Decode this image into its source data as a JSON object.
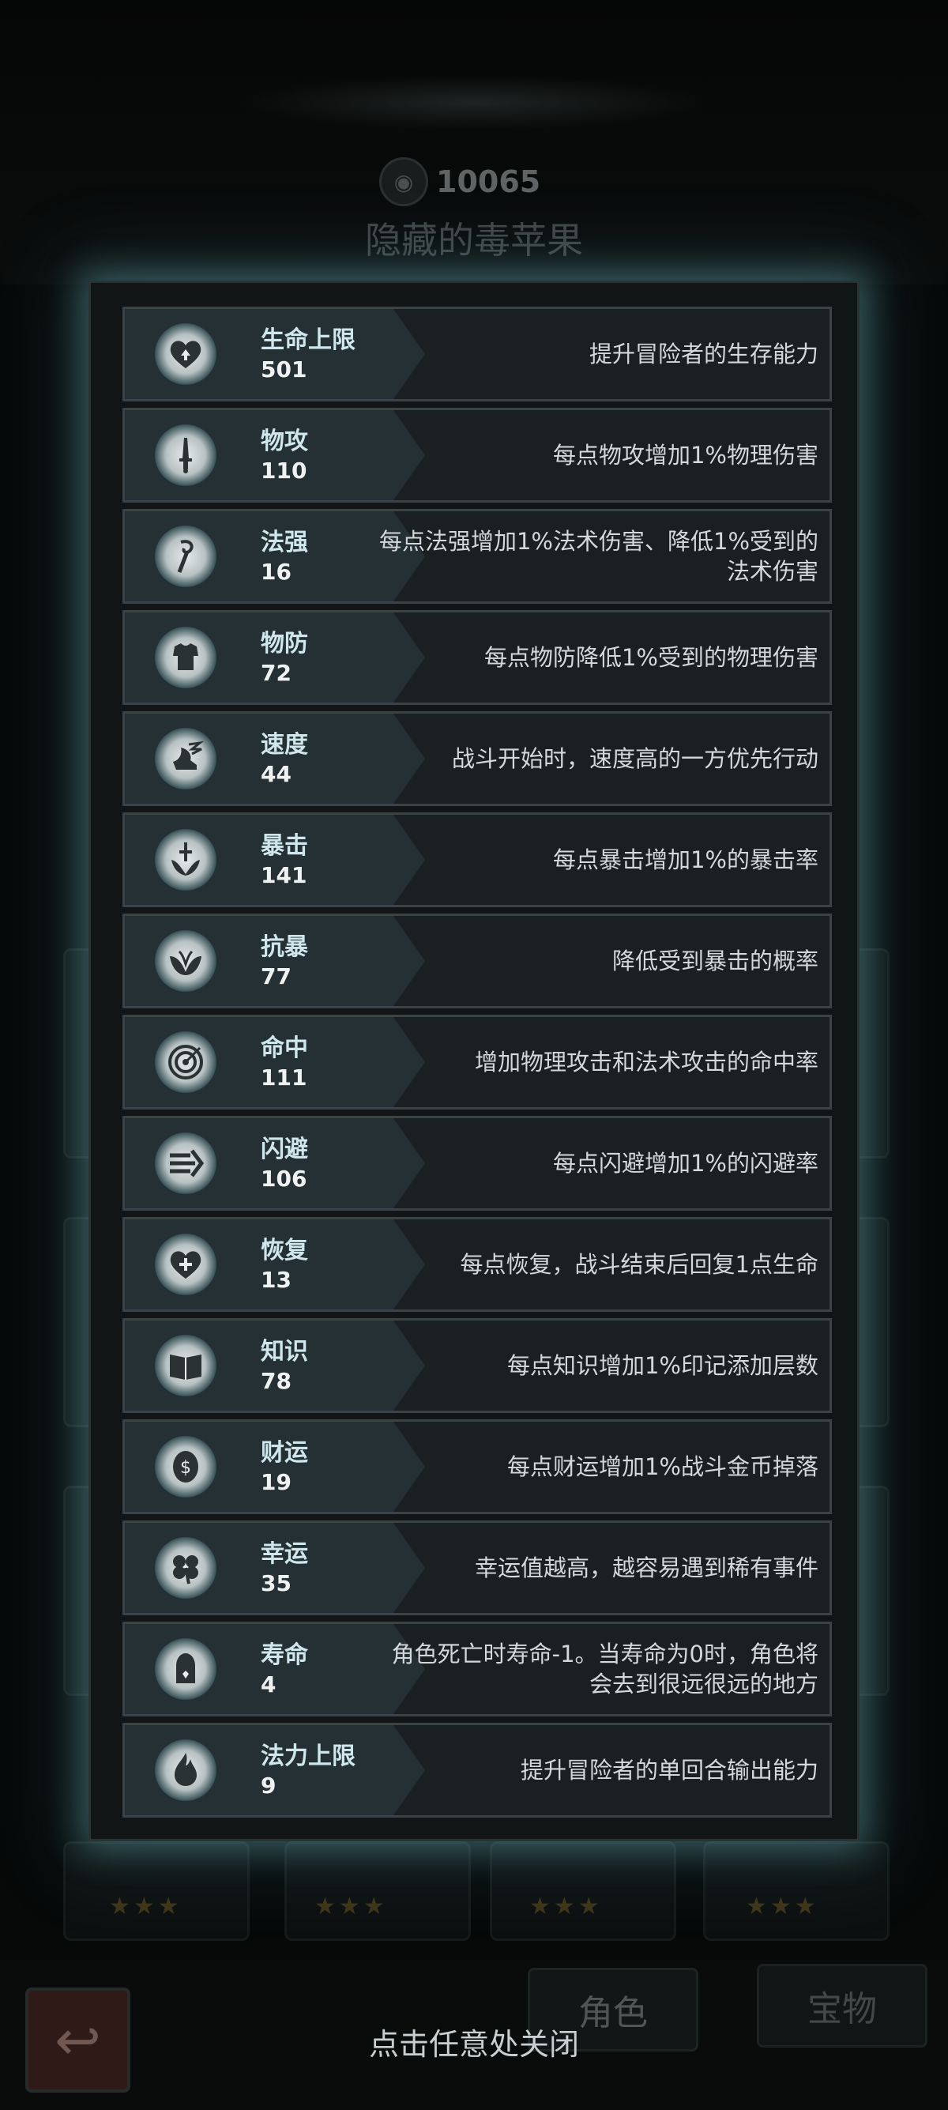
{
  "background": {
    "currency_value": "10065",
    "item_name": "隐藏的毒苹果",
    "tabs": {
      "role": "角色",
      "treasure": "宝物"
    }
  },
  "close_hint": "点击任意处关闭",
  "stats": [
    {
      "name": "生命上限",
      "value": "501",
      "desc": "提升冒险者的生存能力",
      "icon": "heart-up-icon"
    },
    {
      "name": "物攻",
      "value": "110",
      "desc": "每点物攻增加1%物理伤害",
      "icon": "sword-icon"
    },
    {
      "name": "法强",
      "value": "16",
      "desc": "每点法强增加1%法术伤害、降低1%受到的法术伤害",
      "icon": "staff-icon"
    },
    {
      "name": "物防",
      "value": "72",
      "desc": "每点物防降低1%受到的物理伤害",
      "icon": "armor-icon"
    },
    {
      "name": "速度",
      "value": "44",
      "desc": "战斗开始时，速度高的一方优先行动",
      "icon": "winged-boot-icon"
    },
    {
      "name": "暴击",
      "value": "141",
      "desc": "每点暴击增加1%的暴击率",
      "icon": "crit-icon"
    },
    {
      "name": "抗暴",
      "value": "77",
      "desc": "降低受到暴击的概率",
      "icon": "crit-resist-icon"
    },
    {
      "name": "命中",
      "value": "111",
      "desc": "增加物理攻击和法术攻击的命中率",
      "icon": "target-icon"
    },
    {
      "name": "闪避",
      "value": "106",
      "desc": "每点闪避增加1%的闪避率",
      "icon": "dodge-icon"
    },
    {
      "name": "恢复",
      "value": "13",
      "desc": "每点恢复，战斗结束后回复1点生命",
      "icon": "heart-plus-icon"
    },
    {
      "name": "知识",
      "value": "78",
      "desc": "每点知识增加1%印记添加层数",
      "icon": "book-icon"
    },
    {
      "name": "财运",
      "value": "19",
      "desc": "每点财运增加1%战斗金币掉落",
      "icon": "coin-icon"
    },
    {
      "name": "幸运",
      "value": "35",
      "desc": "幸运值越高，越容易遇到稀有事件",
      "icon": "clover-icon"
    },
    {
      "name": "寿命",
      "value": "4",
      "desc": "角色死亡时寿命-1。当寿命为0时，角色将会去到很远很远的地方",
      "icon": "tombstone-icon"
    },
    {
      "name": "法力上限",
      "value": "9",
      "desc": "提升冒险者的单回合输出能力",
      "icon": "flame-icon"
    }
  ]
}
